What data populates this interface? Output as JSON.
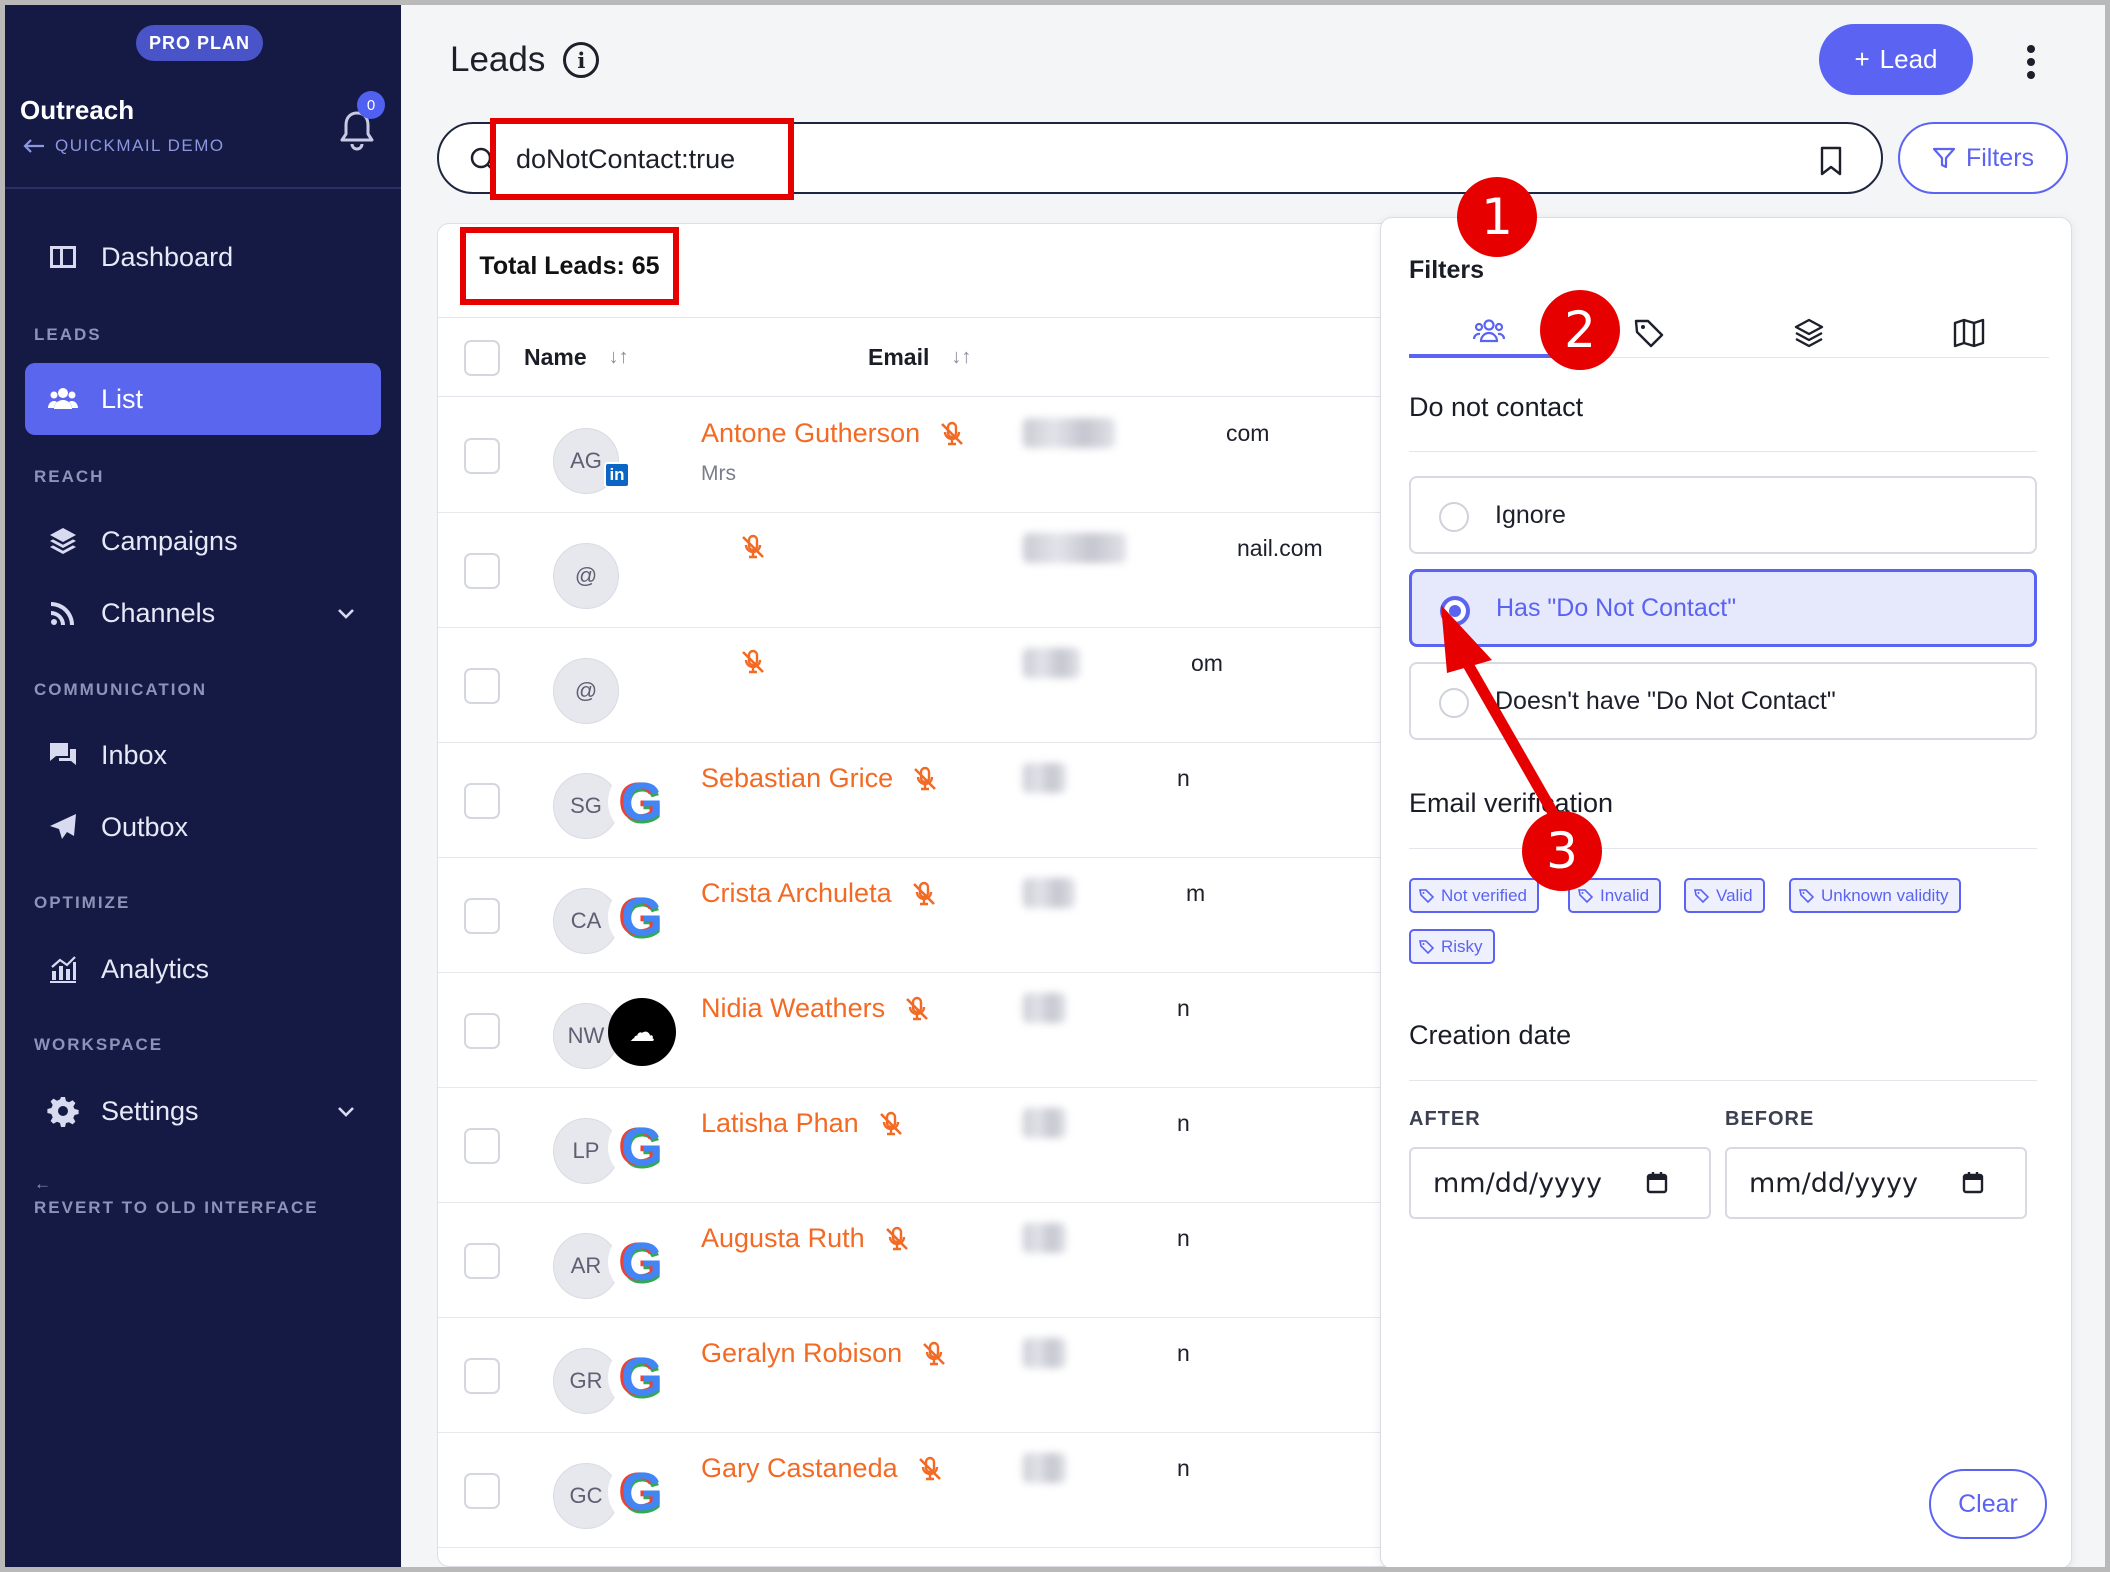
{
  "sidebar": {
    "plan_badge": "PRO PLAN",
    "org_name": "Outreach",
    "back_label": "QUICKMAIL DEMO",
    "notifications_count": "0",
    "sections": {
      "leads": "LEADS",
      "reach": "REACH",
      "communication": "COMMUNICATION",
      "optimize": "OPTIMIZE",
      "workspace": "WORKSPACE"
    },
    "items": {
      "dashboard": "Dashboard",
      "list": "List",
      "campaigns": "Campaigns",
      "channels": "Channels",
      "inbox": "Inbox",
      "outbox": "Outbox",
      "analytics": "Analytics",
      "settings": "Settings"
    },
    "revert_arrow": "←",
    "revert_label": "REVERT TO OLD INTERFACE"
  },
  "header": {
    "title": "Leads",
    "info_glyph": "i",
    "add_lead_label": "Lead",
    "add_lead_glyph": "+"
  },
  "search": {
    "query": "doNotContact:true",
    "filters_label": "Filters"
  },
  "table": {
    "total_label": "Total Leads: 65",
    "columns": {
      "name": "Name",
      "email": "Email",
      "sort_glyph": "↓↑"
    },
    "rows": [
      {
        "initials": "AG",
        "name": "Antone Gutherson",
        "subtitle": "Mrs",
        "source": "linkedin",
        "source_glyph": "in",
        "email_tail": "com"
      },
      {
        "initials": "@",
        "name": "",
        "subtitle": "",
        "source": "none",
        "source_glyph": "",
        "email_tail": "nail.com"
      },
      {
        "initials": "@",
        "name": "",
        "subtitle": "",
        "source": "none",
        "source_glyph": "",
        "email_tail": "om"
      },
      {
        "initials": "SG",
        "name": "Sebastian Grice",
        "subtitle": "",
        "source": "google",
        "source_glyph": "G",
        "email_tail": "n"
      },
      {
        "initials": "CA",
        "name": "Crista Archuleta",
        "subtitle": "",
        "source": "google",
        "source_glyph": "G",
        "email_tail": "m"
      },
      {
        "initials": "NW",
        "name": "Nidia Weathers",
        "subtitle": "",
        "source": "soundcloud",
        "source_glyph": "☁",
        "email_tail": "n"
      },
      {
        "initials": "LP",
        "name": "Latisha Phan",
        "subtitle": "",
        "source": "google",
        "source_glyph": "G",
        "email_tail": "n"
      },
      {
        "initials": "AR",
        "name": "Augusta Ruth",
        "subtitle": "",
        "source": "google",
        "source_glyph": "G",
        "email_tail": "n"
      },
      {
        "initials": "GR",
        "name": "Geralyn Robison",
        "subtitle": "",
        "source": "google",
        "source_glyph": "G",
        "email_tail": "n"
      },
      {
        "initials": "GC",
        "name": "Gary Castaneda",
        "subtitle": "",
        "source": "google",
        "source_glyph": "G",
        "email_tail": "n"
      }
    ]
  },
  "filters_panel": {
    "title": "Filters",
    "tabs": [
      "people-icon",
      "tag-icon",
      "layers-icon",
      "map-icon"
    ],
    "do_not_contact": {
      "heading": "Do not contact",
      "options": [
        "Ignore",
        "Has \"Do Not Contact\"",
        "Doesn't have \"Do Not Contact\""
      ],
      "selected": "Has \"Do Not Contact\""
    },
    "email_verification": {
      "heading": "Email verification",
      "chips": [
        "Not verified",
        "Invalid",
        "Valid",
        "Unknown validity",
        "Risky"
      ]
    },
    "creation_date": {
      "heading": "Creation date",
      "after_label": "AFTER",
      "before_label": "BEFORE",
      "after_placeholder": "mm/dd/yyyy",
      "before_placeholder": "mm/dd/yyyy"
    },
    "clear_label": "Clear"
  },
  "annotations": {
    "step1": "1",
    "step2": "2",
    "step3": "3"
  },
  "colors": {
    "sidebar_bg": "#141a44",
    "accent": "#5b63f2",
    "lead_name": "#f26a24",
    "annotation_red": "#e60000"
  }
}
